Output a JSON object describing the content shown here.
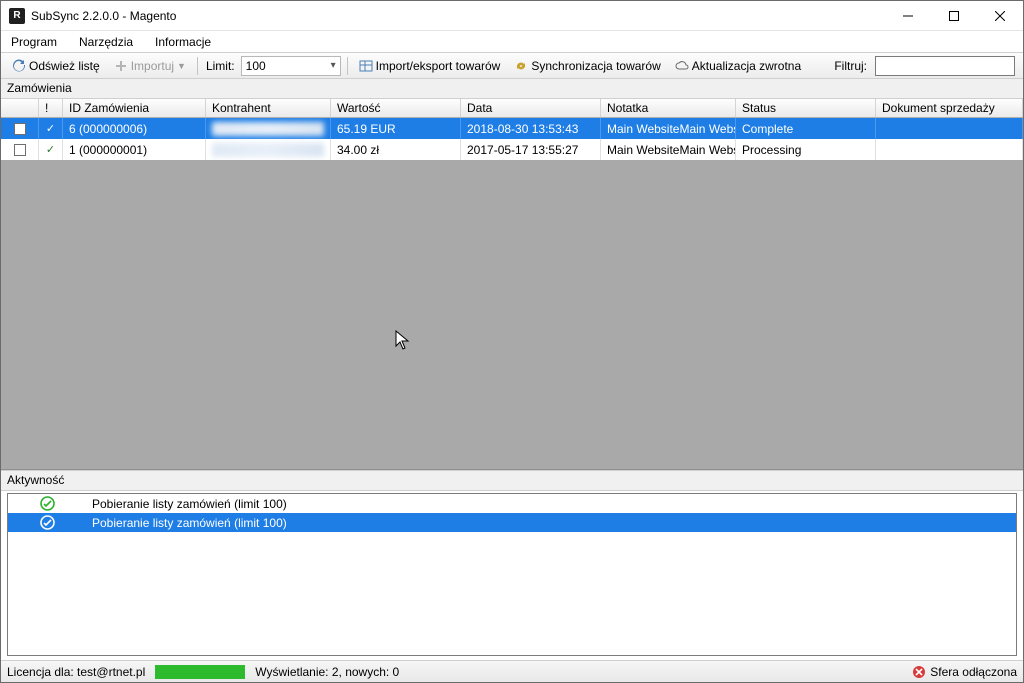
{
  "window": {
    "title": "SubSync 2.2.0.0 - Magento",
    "app_icon_letter": "R"
  },
  "menu": {
    "items": [
      "Program",
      "Narzędzia",
      "Informacje"
    ]
  },
  "toolbar": {
    "refresh": "Odśwież listę",
    "import": "Importuj",
    "limit_label": "Limit:",
    "limit_value": "100",
    "import_export": "Import/eksport towarów",
    "sync": "Synchronizacja towarów",
    "update": "Aktualizacja zwrotna",
    "filter_label": "Filtruj:",
    "filter_value": ""
  },
  "orders_section_label": "Zamówienia",
  "orders_columns": {
    "checkbox": "",
    "tick": "!",
    "id": "ID Zamówienia",
    "contractor": "Kontrahent",
    "value": "Wartość",
    "date": "Data",
    "note": "Notatka",
    "status": "Status",
    "doc": "Dokument sprzedaży"
  },
  "orders": [
    {
      "selected": true,
      "id": "6 (000000006)",
      "contractor": "██████",
      "value": "65.19 EUR",
      "date": "2018-08-30 13:53:43",
      "note": "Main WebsiteMain Websit...",
      "status": "Complete",
      "doc": ""
    },
    {
      "selected": false,
      "id": "1 (000000001)",
      "contractor": "██████",
      "value": "34.00 zł",
      "date": "2017-05-17 13:55:27",
      "note": "Main WebsiteMain Websit...",
      "status": "Processing",
      "doc": ""
    }
  ],
  "activity_section_label": "Aktywność",
  "activity": [
    {
      "selected": false,
      "text": "Pobieranie listy zamówień (limit 100)"
    },
    {
      "selected": true,
      "text": "Pobieranie listy zamówień (limit 100)"
    }
  ],
  "status": {
    "license": "Licencja dla: test@rtnet.pl",
    "display": "Wyświetlanie: 2, nowych: 0",
    "sphere": "Sfera odłączona"
  }
}
